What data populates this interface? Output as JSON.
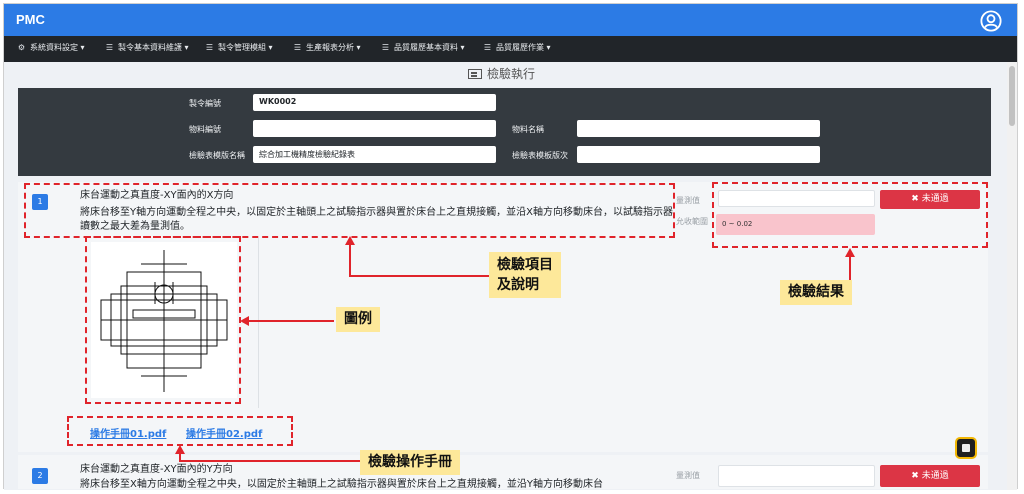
{
  "app": {
    "brand": "PMC"
  },
  "menu": [
    {
      "icon": "gear-icon",
      "glyph": "⚙",
      "label": "系統資料設定 ▾"
    },
    {
      "icon": "list-icon",
      "glyph": "☰",
      "label": "製令基本資料維護 ▾"
    },
    {
      "icon": "list-icon",
      "glyph": "☰",
      "label": "製令管理模組 ▾"
    },
    {
      "icon": "list-icon",
      "glyph": "☰",
      "label": "生產報表分析 ▾"
    },
    {
      "icon": "list-icon",
      "glyph": "☰",
      "label": "品質履歷基本資料 ▾"
    },
    {
      "icon": "list-icon",
      "glyph": "☰",
      "label": "品質履歷作業 ▾"
    }
  ],
  "page": {
    "title": "檢驗執行"
  },
  "form": {
    "order_no_label": "製令編號",
    "order_no": "WK0002",
    "part_no_label": "物料編號",
    "part_no": "",
    "part_name_label": "物料名稱",
    "part_name": "",
    "template_name_label": "檢驗表模版名稱",
    "template_name": "綜合加工機精度檢驗紀錄表",
    "template_version_label": "檢驗表模板版次",
    "template_version": ""
  },
  "items": [
    {
      "num": "1",
      "title": "床台運動之真直度-XY面內的X方向",
      "desc": "將床台移至Y軸方向運動全程之中央，以固定於主軸頭上之試驗指示器與置於床台上之直規接觸，並沿X軸方向移動床台，以試驗指示器讀數之最大差為量測值。",
      "measure_label": "量測值",
      "allowed_label": "允收範圍",
      "range": "0 ~ 0.02",
      "status": "✖ 未通過"
    },
    {
      "num": "2",
      "title": "床台運動之真直度-XY面內的Y方向",
      "desc": "將床台移至X軸方向運動全程之中央，以固定於主軸頭上之試驗指示器與置於床台上之直規接觸，並沿Y軸方向移動床台",
      "measure_label": "量測值",
      "status": "✖ 未通過"
    }
  ],
  "manuals": [
    "操作手冊01.pdf",
    "操作手冊02.pdf"
  ],
  "callouts": {
    "item": "檢驗項目\n及說明",
    "diagram": "圖例",
    "result": "檢驗結果",
    "manual": "檢驗操作手冊"
  },
  "colors": {
    "primary": "#2c7be5",
    "danger": "#dc3545",
    "dark": "#343a40",
    "annotation": "#e0242b",
    "callout_bg": "#fde89a"
  }
}
